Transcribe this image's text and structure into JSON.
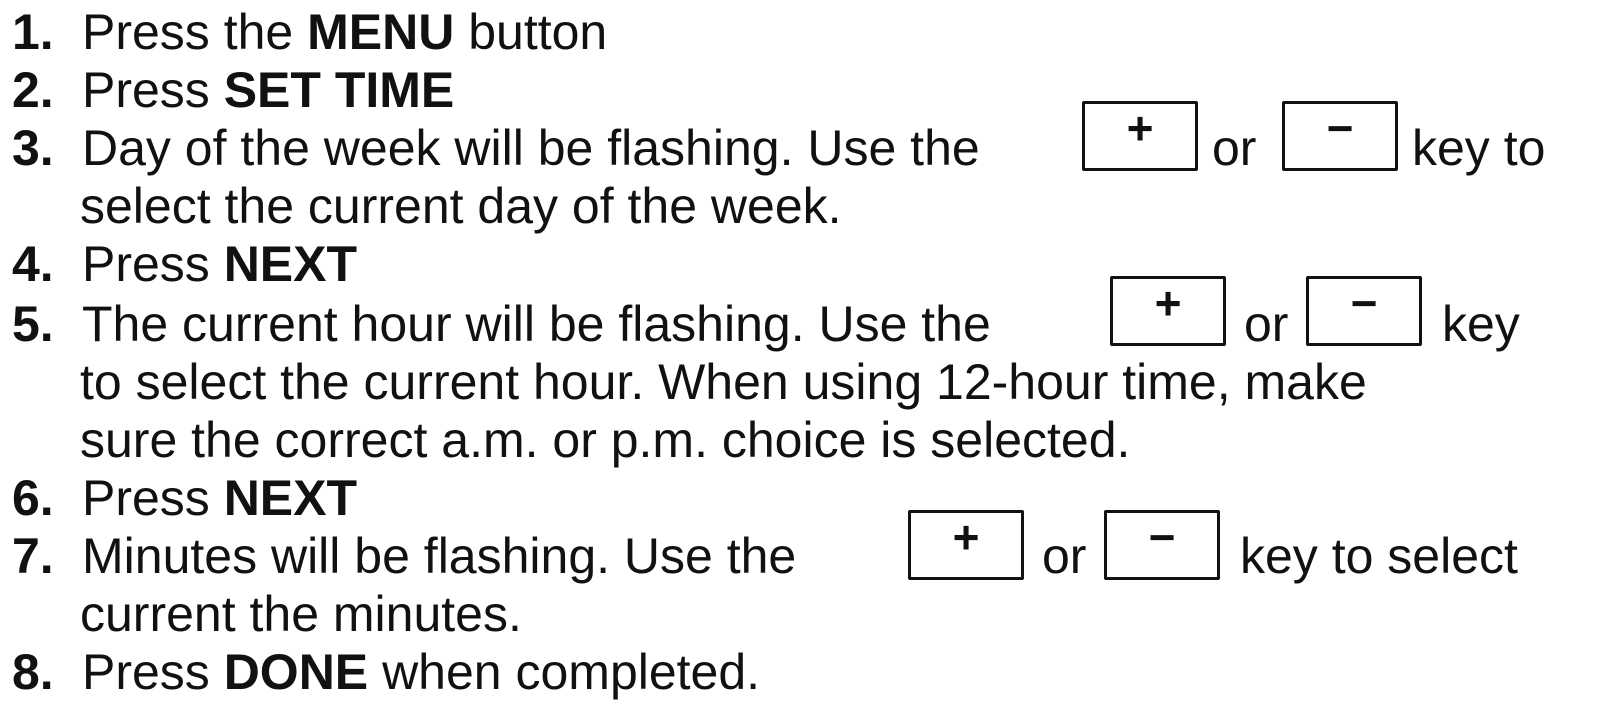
{
  "steps": [
    {
      "number": "1.",
      "pre": "Press the ",
      "bold": "MENU",
      "post": " button"
    },
    {
      "number": "2.",
      "pre": "Press ",
      "bold": "SET TIME"
    },
    {
      "number": "3.",
      "line1_pre": "Day of the week will be flashing.  Use the",
      "plus": "+",
      "or": "or",
      "minus": "−",
      "line1_post": "key to",
      "line2": "select the current day of the week."
    },
    {
      "number": "4.",
      "pre": "Press ",
      "bold": "NEXT"
    },
    {
      "number": "5.",
      "line1_pre": "The current hour will be flashing.  Use the",
      "plus": "+",
      "or": "or",
      "minus": "−",
      "line1_post": "key",
      "line2": "to select the current hour.  When using 12-hour time, make",
      "line3": "sure the correct a.m. or p.m. choice is selected."
    },
    {
      "number": "6.",
      "pre": "Press ",
      "bold": "NEXT"
    },
    {
      "number": "7.",
      "line1_pre": "Minutes will be flashing.  Use the",
      "plus": "+",
      "or": "or",
      "minus": "−",
      "line1_post": "key to select",
      "line2": "current the minutes."
    },
    {
      "number": "8.",
      "pre": "Press ",
      "bold": "DONE",
      "post": " when completed."
    }
  ]
}
